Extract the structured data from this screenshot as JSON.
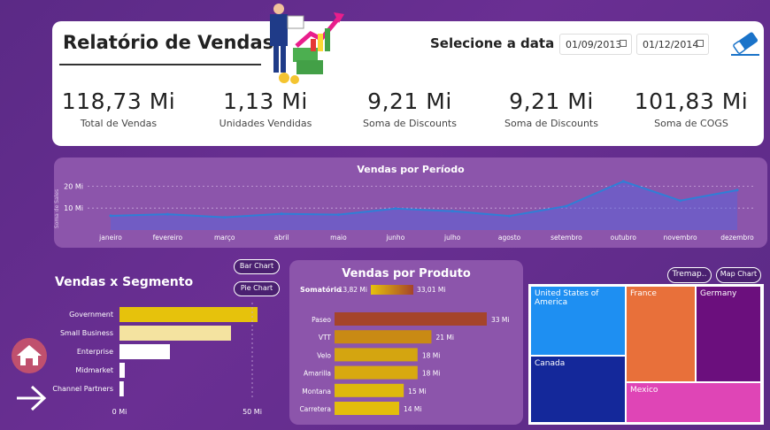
{
  "header": {
    "title": "Relatório de Vendas",
    "select_label": "Selecione a data",
    "date_start": "01/09/2013",
    "date_end": "01/12/2014"
  },
  "kpis": [
    {
      "value": "118,73 Mi",
      "label": "Total de Vendas"
    },
    {
      "value": "1,13 Mi",
      "label": "Unidades Vendidas"
    },
    {
      "value": "9,21 Mi",
      "label": "Soma de Discounts"
    },
    {
      "value": "9,21 Mi",
      "label": "Soma de Discounts"
    },
    {
      "value": "101,83 Mi",
      "label": "Soma de COGS"
    }
  ],
  "colors": {
    "accent": "#e6c20c",
    "line": "#2f7fd6",
    "panel": "#8c55ab",
    "bg": "#5b2a86"
  },
  "buttons": {
    "bar_chart": "Bar Chart",
    "pie_chart": "Pie Chart",
    "treemap": "Tremap..",
    "map_chart": "Map Chart"
  },
  "chart_data": [
    {
      "type": "area",
      "title": "Vendas por Período",
      "ylabel": "Soma de Sales",
      "categories": [
        "janeiro",
        "fevereiro",
        "março",
        "abril",
        "maio",
        "junho",
        "julho",
        "agosto",
        "setembro",
        "outubro",
        "novembro",
        "dezembro"
      ],
      "values": [
        6.5,
        7.2,
        5.8,
        7.4,
        7.0,
        9.8,
        8.6,
        6.4,
        10.9,
        22.2,
        13.4,
        18.2
      ],
      "yticks": [
        "20 Mi",
        "10 Mi"
      ],
      "ylim": [
        0,
        25
      ]
    },
    {
      "type": "bar",
      "title": "Vendas x Segmento",
      "categories": [
        "Government",
        "Small Business",
        "Enterprise",
        "Midmarket",
        "Channel Partners"
      ],
      "values": [
        52,
        42,
        19,
        2,
        1.6
      ],
      "xticks": [
        "0 Mi",
        "50 Mi"
      ],
      "xlim": [
        0,
        55
      ]
    },
    {
      "type": "bar",
      "title": "Vendas por Produto",
      "total_label": "Somatório",
      "min_label": "13,82 Mi",
      "max_label": "33,01 Mi",
      "categories": [
        "Paseo",
        "VTT",
        "Velo",
        "Amarilla",
        "Montana",
        "Carretera"
      ],
      "values": [
        33,
        21,
        18,
        18,
        15,
        14
      ],
      "labels": [
        "33 Mi",
        "21 Mi",
        "18 Mi",
        "18 Mi",
        "15 Mi",
        "14 Mi"
      ]
    },
    {
      "type": "treemap",
      "items": [
        "United States of America",
        "France",
        "Germany",
        "Canada",
        "Mexico"
      ]
    }
  ]
}
